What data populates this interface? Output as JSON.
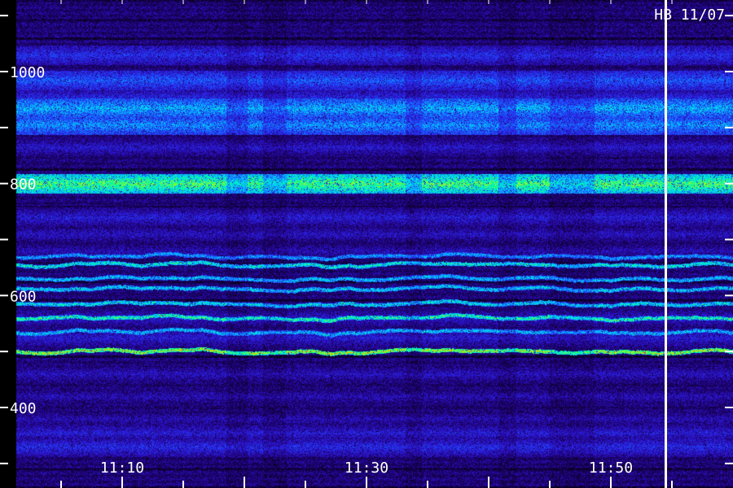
{
  "chart_data": {
    "type": "heatmap",
    "title": "HB 11/07",
    "xlabel": "",
    "ylabel": "",
    "x_range_minutes": [
      1,
      60
    ],
    "y_range": [
      300,
      1050
    ],
    "x_ticks": [
      {
        "label": "11:10",
        "minute": 10
      },
      {
        "label": "11:30",
        "minute": 30
      },
      {
        "label": "11:50",
        "minute": 50
      }
    ],
    "y_ticks": [
      {
        "label": "1000",
        "value": 1000
      },
      {
        "label": "800",
        "value": 800
      },
      {
        "label": "600",
        "value": 600
      },
      {
        "label": "400",
        "value": 400
      }
    ],
    "marker_time_minute": 54.5,
    "diffuse_bands": [
      {
        "value": 1030,
        "level": 0.42
      },
      {
        "value": 985,
        "level": 0.5
      },
      {
        "value": 955,
        "level": 0.38
      },
      {
        "value": 935,
        "level": 0.62
      },
      {
        "value": 905,
        "level": 0.58
      },
      {
        "value": 865,
        "level": 0.34
      },
      {
        "value": 800,
        "level": 0.78
      },
      {
        "value": 740,
        "level": 0.36
      },
      {
        "value": 710,
        "level": 0.32
      },
      {
        "value": 680,
        "level": 0.3
      },
      {
        "value": 560,
        "level": 0.34
      },
      {
        "value": 525,
        "level": 0.36
      },
      {
        "value": 460,
        "level": 0.32
      },
      {
        "value": 420,
        "level": 0.3
      },
      {
        "value": 380,
        "level": 0.3
      },
      {
        "value": 355,
        "level": 0.36
      },
      {
        "value": 330,
        "level": 0.4
      }
    ],
    "tones": [
      {
        "value": 670,
        "level": 0.62
      },
      {
        "value": 655,
        "level": 0.72
      },
      {
        "value": 630,
        "level": 0.66
      },
      {
        "value": 612,
        "level": 0.68
      },
      {
        "value": 585,
        "level": 0.7
      },
      {
        "value": 560,
        "level": 0.76
      },
      {
        "value": 535,
        "level": 0.66
      },
      {
        "value": 500,
        "level": 0.86
      }
    ],
    "quiet_intervals_minutes": [
      [
        18.5,
        20.2
      ],
      [
        21.5,
        23.4
      ],
      [
        33.2,
        34.5
      ],
      [
        40.8,
        42.2
      ],
      [
        45.0,
        48.6
      ]
    ]
  }
}
